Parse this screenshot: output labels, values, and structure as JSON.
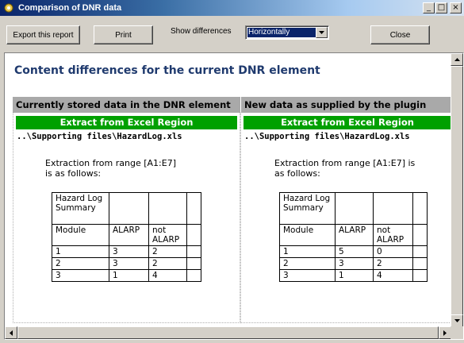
{
  "window": {
    "title": "Comparison of DNR data",
    "icon": "gear-icon",
    "controls": {
      "minimize": "_",
      "maximize": "□",
      "close": "×"
    }
  },
  "toolbar": {
    "export_label": "Export this report",
    "print_label": "Print",
    "show_diff_label": "Show differences",
    "show_diff_value": "Horizontally",
    "close_label": "Close"
  },
  "report": {
    "heading": "Content differences for the current DNR element",
    "panels": [
      {
        "column_header": "Currently stored data in the DNR element",
        "section_title": "Extract from Excel Region",
        "file_path": "..\\Supporting files\\HazardLog.xls",
        "extract_line1": "Extraction from range [A1:E7]",
        "extract_line2": "is as follows:",
        "table": [
          [
            "Hazard Log Summary",
            "",
            "",
            ""
          ],
          [
            "Module",
            "ALARP",
            "not ALARP",
            ""
          ],
          [
            "1",
            "3",
            "2",
            ""
          ],
          [
            "2",
            "3",
            "2",
            ""
          ],
          [
            "3",
            "1",
            "4",
            ""
          ]
        ]
      },
      {
        "column_header": "New data as supplied by the plugin",
        "section_title": "Extract from Excel Region",
        "file_path": "..\\Supporting files\\HazardLog.xls",
        "extract_line1": "Extraction from range [A1:E7] is",
        "extract_line2": "as follows:",
        "table": [
          [
            "Hazard Log Summary",
            "",
            "",
            ""
          ],
          [
            "Module",
            "ALARP",
            "not ALARP",
            ""
          ],
          [
            "1",
            "5",
            "0",
            ""
          ],
          [
            "2",
            "3",
            "2",
            ""
          ],
          [
            "3",
            "1",
            "4",
            ""
          ]
        ]
      }
    ]
  },
  "colors": {
    "green_bar": "#00a000",
    "heading": "#1f3a6e",
    "column_header_bg": "#a9a9a9"
  }
}
